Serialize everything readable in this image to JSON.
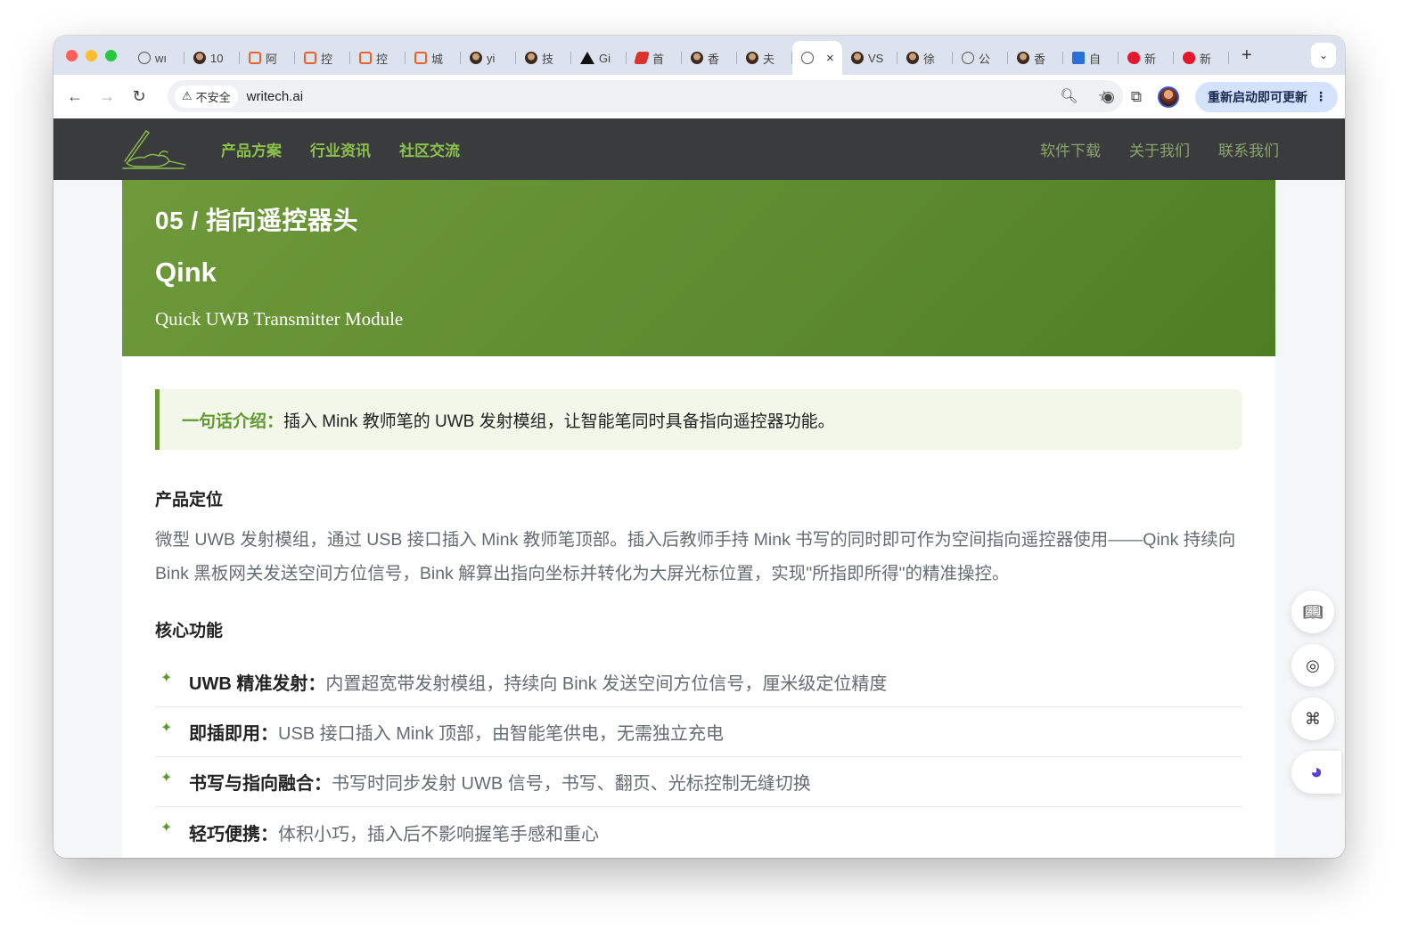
{
  "browser": {
    "tabs": [
      {
        "icon": "globe",
        "label": "wı"
      },
      {
        "icon": "face",
        "label": "10"
      },
      {
        "icon": "code",
        "label": "阿"
      },
      {
        "icon": "code",
        "label": "控"
      },
      {
        "icon": "code",
        "label": "控"
      },
      {
        "icon": "code",
        "label": "城"
      },
      {
        "icon": "face",
        "label": "yi"
      },
      {
        "icon": "face",
        "label": "技"
      },
      {
        "icon": "triangle",
        "label": "Gi"
      },
      {
        "icon": "red",
        "label": "首"
      },
      {
        "icon": "face",
        "label": "香"
      },
      {
        "icon": "face",
        "label": "夫"
      },
      {
        "icon": "globe",
        "label": "",
        "active": true
      },
      {
        "icon": "face",
        "label": "VS"
      },
      {
        "icon": "face",
        "label": "徐"
      },
      {
        "icon": "globe",
        "label": "公"
      },
      {
        "icon": "face",
        "label": "香"
      },
      {
        "icon": "blue",
        "label": "自"
      },
      {
        "icon": "weibo",
        "label": "新"
      },
      {
        "icon": "weibo",
        "label": "新"
      }
    ],
    "security_label": "不安全",
    "url": "writech.ai",
    "update_button": "重新启动即可更新"
  },
  "site": {
    "nav_left": [
      "产品方案",
      "行业资讯",
      "社区交流"
    ],
    "nav_right": [
      "软件下载",
      "关于我们",
      "联系我们"
    ]
  },
  "hero": {
    "eyebrow": "05 / 指向遥控器头",
    "title": "Qink",
    "subtitle": "Quick UWB Transmitter Module"
  },
  "intro": {
    "label": "一句话介绍：",
    "text": "插入 Mink 教师笔的 UWB 发射模组，让智能笔同时具备指向遥控器功能。"
  },
  "positioning": {
    "title": "产品定位",
    "text": "微型 UWB 发射模组，通过 USB 接口插入 Mink 教师笔顶部。插入后教师手持 Mink 书写的同时即可作为空间指向遥控器使用——Qink 持续向 Bink 黑板网关发送空间方位信号，Bink 解算出指向坐标并转化为大屏光标位置，实现\"所指即所得\"的精准操控。"
  },
  "core": {
    "title": "核心功能",
    "features": [
      {
        "title": "UWB 精准发射：",
        "text": "内置超宽带发射模组，持续向 Bink 发送空间方位信号，厘米级定位精度"
      },
      {
        "title": "即插即用：",
        "text": "USB 接口插入 Mink 顶部，由智能笔供电，无需独立充电"
      },
      {
        "title": "书写与指向融合：",
        "text": "书写时同步发射 UWB 信号，书写、翻页、光标控制无缝切换"
      },
      {
        "title": "轻巧便携：",
        "text": "体积小巧，插入后不影响握笔手感和重心"
      }
    ]
  },
  "colors": {
    "brand_green": "#6a9a38",
    "nav_bg": "#3a3b3d",
    "nav_link": "#8ac24a"
  }
}
